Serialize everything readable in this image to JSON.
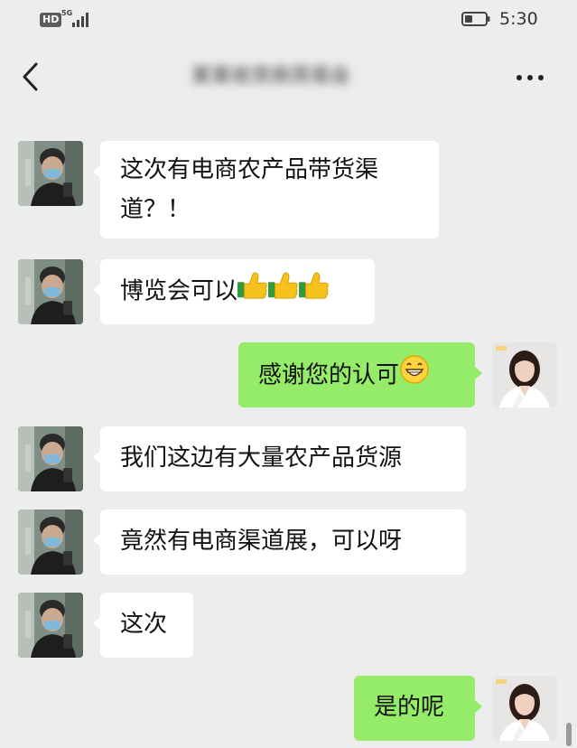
{
  "status_bar": {
    "hd_badge": "HD",
    "network": "5G",
    "time": "5:30"
  },
  "header": {
    "chat_title": "某某收货商贸易会"
  },
  "messages": [
    {
      "side": "incoming",
      "text": "这次有电商农产品带货渠",
      "text_line2": "道？！"
    },
    {
      "side": "incoming",
      "text": "博览会可以",
      "emoji": "thumbs-up-icon x3"
    },
    {
      "side": "outgoing",
      "text": "感谢您的认可",
      "emoji": "grin-icon"
    },
    {
      "side": "incoming",
      "text": "我们这边有大量农产品货源"
    },
    {
      "side": "incoming",
      "text": "竟然有电商渠道展，可以呀"
    },
    {
      "side": "incoming",
      "text": "这次"
    },
    {
      "side": "outgoing",
      "text": "是的呢"
    }
  ],
  "colors": {
    "background": "#ededed",
    "incoming_bubble": "#ffffff",
    "outgoing_bubble": "#95ec69"
  }
}
